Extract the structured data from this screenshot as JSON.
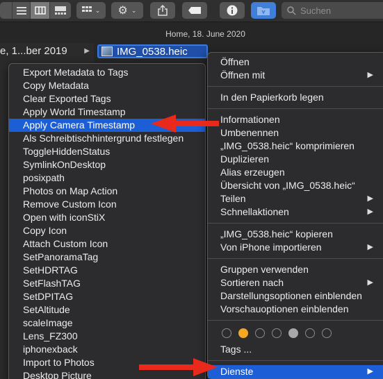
{
  "toolbar": {
    "search_placeholder": "Suchen",
    "icons": [
      "list-view-icon",
      "column-view-icon",
      "gallery-view-icon",
      "group-icon",
      "action-gear-icon",
      "share-icon",
      "tag-icon",
      "info-icon",
      "folder-icon",
      "search-icon"
    ]
  },
  "pathbar": {
    "title": "Home, 18. June 2020"
  },
  "column": {
    "left_item": "e, 1...ber 2019",
    "selected_file": "IMG_0538.heic"
  },
  "services_menu": {
    "items": [
      "Export Metadata to Tags",
      "Copy Metadata",
      "Clear Exported Tags",
      "Apply World Timestamp",
      "Apply Camera Timestamp",
      "Als Schreibtischhintergrund festlegen",
      "ToggleHiddenStatus",
      "SymlinkOnDesktop",
      "posixpath",
      "Photos on Map Action",
      "Remove Custom Icon",
      "Open with iconStiX",
      "Copy Icon",
      "Attach Custom Icon",
      "SetPanoramaTag",
      "SetHDRTAG",
      "SetFlashTAG",
      "SetDPITAG",
      "SetAltitude",
      "scaleImage",
      "Lens_FZ300",
      "iphonexback",
      "Import to Photos",
      "Desktop Picture"
    ],
    "highlighted": "Apply Camera Timestamp"
  },
  "context_menu": {
    "open": "Öffnen",
    "open_with": "Öffnen mit",
    "trash": "In den Papierkorb legen",
    "info": "Informationen",
    "rename": "Umbenennen",
    "compress": "„IMG_0538.heic“ komprimieren",
    "duplicate": "Duplizieren",
    "alias": "Alias erzeugen",
    "quicklook": "Übersicht von „IMG_0538.heic“",
    "share": "Teilen",
    "quick_actions": "Schnellaktionen",
    "copy": "„IMG_0538.heic“ kopieren",
    "iphone_import": "Von iPhone importieren",
    "use_groups": "Gruppen verwenden",
    "sort_by": "Sortieren nach",
    "view_options": "Darstellungsoptionen einblenden",
    "preview_options": "Vorschauoptionen einblenden",
    "tags": "Tags ...",
    "services": "Dienste",
    "chevron": "▶",
    "tag_colors": [
      "none",
      "orange",
      "none",
      "none",
      "grey",
      "none",
      "none"
    ]
  },
  "colors": {
    "highlight": "#1c5ed6",
    "arrow": "#e8291c",
    "menu_bg": "#2c2c2e"
  }
}
